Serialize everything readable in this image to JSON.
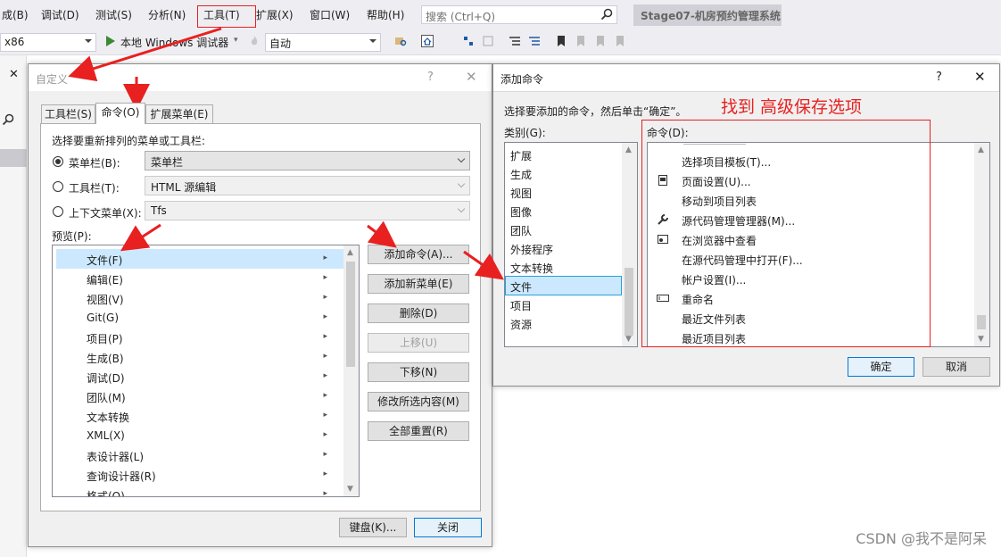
{
  "menubar": {
    "items": [
      "成(B)",
      "调试(D)",
      "测试(S)",
      "分析(N)",
      "工具(T)",
      "扩展(X)",
      "窗口(W)",
      "帮助(H)"
    ],
    "search_placeholder": "搜索 (Ctrl+Q)",
    "solution_title": "Stage07-机房预约管理系统"
  },
  "toolbar": {
    "platform": "x86",
    "run_label": "本地 Windows 调试器",
    "config": "自动"
  },
  "customize_dialog": {
    "title": "自定义",
    "help": "?",
    "close_glyph": "✕",
    "tabs": [
      "工具栏(S)",
      "命令(O)",
      "扩展菜单(E)"
    ],
    "choose_label": "选择要重新排列的菜单或工具栏:",
    "options": [
      {
        "label": "菜单栏(B):",
        "value": "菜单栏",
        "selected": true
      },
      {
        "label": "工具栏(T):",
        "value": "HTML 源编辑",
        "selected": false
      },
      {
        "label": "上下文菜单(X):",
        "value": "Tfs",
        "selected": false
      }
    ],
    "preview_label": "预览(P):",
    "preview_items": [
      "文件(F)",
      "编辑(E)",
      "视图(V)",
      "Git(G)",
      "项目(P)",
      "生成(B)",
      "调试(D)",
      "团队(M)",
      "文本转换",
      "XML(X)",
      "表设计器(L)",
      "查询设计器(R)",
      "格式(O)"
    ],
    "buttons": [
      "添加命令(A)...",
      "添加新菜单(E)",
      "删除(D)",
      "上移(U)",
      "下移(N)",
      "修改所选内容(M)",
      "全部重置(R)"
    ],
    "footer_buttons": [
      "键盘(K)...",
      "关闭"
    ]
  },
  "add_command_dialog": {
    "title": "添加命令",
    "help": "?",
    "close_glyph": "✕",
    "instruction": "选择要添加的命令，然后单击“确定”。",
    "category_label": "类别(G):",
    "categories": [
      "扩展",
      "生成",
      "视图",
      "图像",
      "团队",
      "外接程序",
      "文本转换",
      "文件",
      "项目",
      "资源"
    ],
    "selected_category": "文件",
    "command_label": "命令(D):",
    "commands": [
      "选择项目模板(T)...",
      "页面设置(U)...",
      "移动到项目列表",
      "源代码管理管理器(M)...",
      "在浏览器中查看",
      "在源代码管理中打开(F)...",
      "帐户设置(I)...",
      "重命名",
      "最近文件列表",
      "最近项目列表"
    ],
    "ok": "确定",
    "cancel": "取消"
  },
  "annotation": {
    "text": "找到 高级保存选项",
    "color": "#e82020"
  },
  "watermark": "CSDN @我不是阿呆",
  "colors": {
    "selection": "#cce8ff",
    "dialog_bg": "#f0f0f0",
    "annotation_red": "#e82020"
  }
}
